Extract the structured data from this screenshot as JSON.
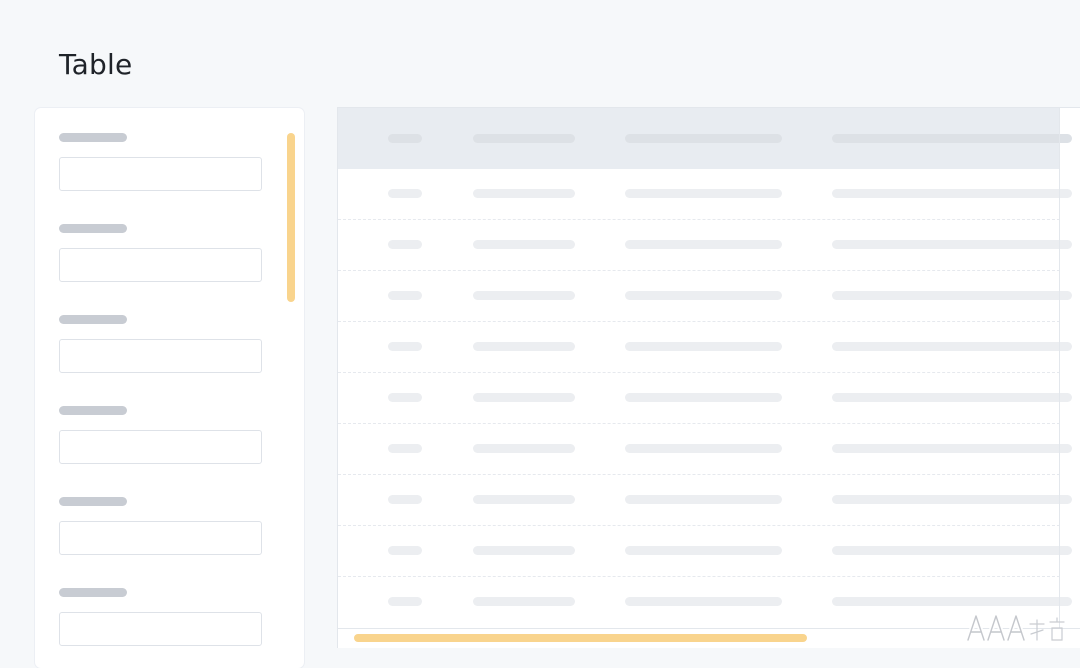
{
  "page": {
    "title": "Table"
  },
  "filter_panel": {
    "fields": [
      {
        "label": "",
        "value": ""
      },
      {
        "label": "",
        "value": ""
      },
      {
        "label": "",
        "value": ""
      },
      {
        "label": "",
        "value": ""
      },
      {
        "label": "",
        "value": ""
      },
      {
        "label": "",
        "value": ""
      }
    ],
    "scrollbar_color": "#f9d48d"
  },
  "table": {
    "header_background": "#e8ecf1",
    "column_count": 4,
    "visible_row_count": 9,
    "scrollbar_color": "#f9d48d"
  },
  "watermark": {
    "mark": "AAA",
    "icon": "watermark-logo-icon"
  },
  "colors": {
    "page_background": "#f6f8fa",
    "accent": "#f9d48d",
    "placeholder": "#c8ccd3"
  }
}
